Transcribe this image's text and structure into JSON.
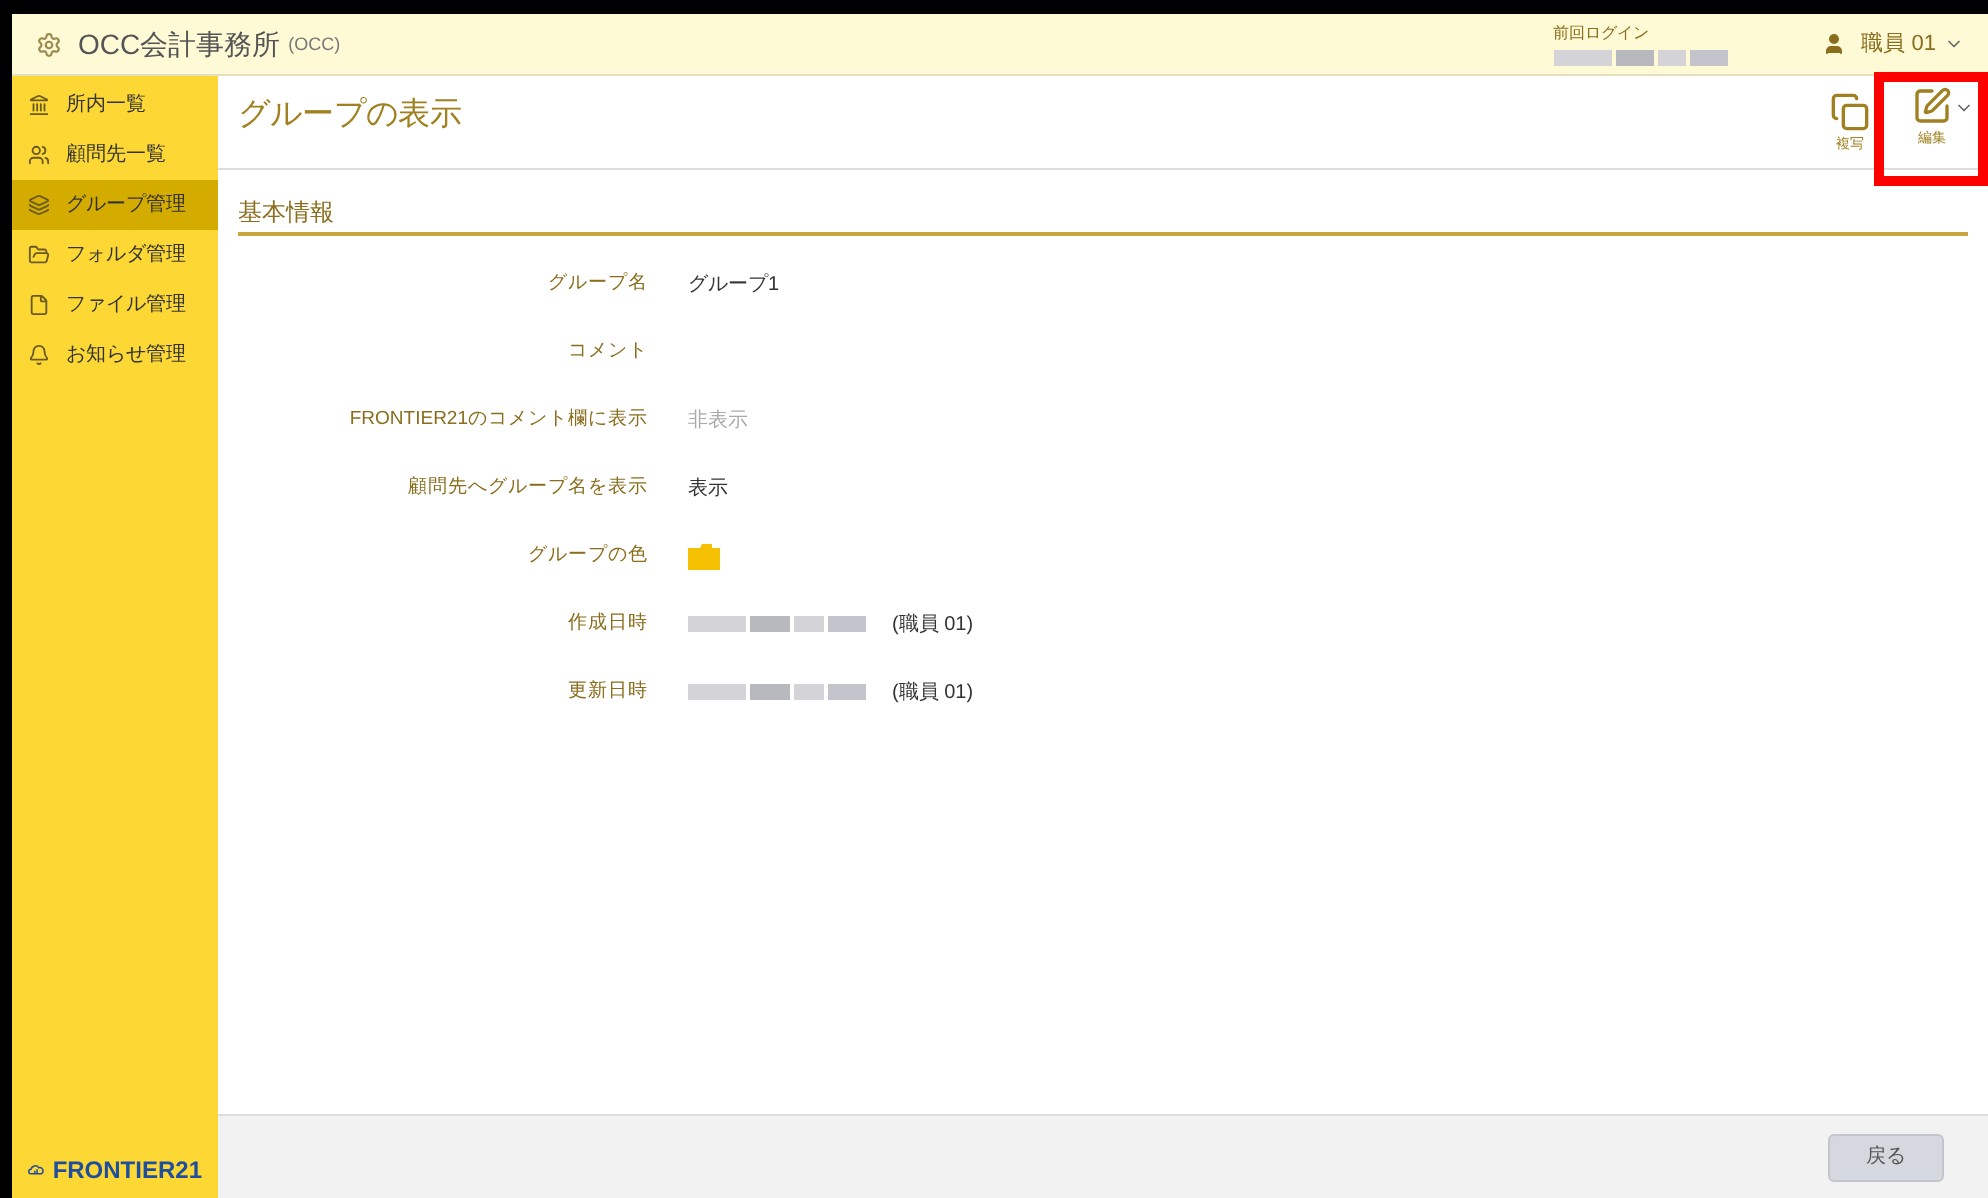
{
  "header": {
    "title": "OCC会計事務所",
    "subtitle": "(OCC)",
    "last_login_label": "前回ログイン",
    "user": "職員 01"
  },
  "sidebar": {
    "items": [
      {
        "label": "所内一覧",
        "selected": false
      },
      {
        "label": "顧問先一覧",
        "selected": false
      },
      {
        "label": "グループ管理",
        "selected": true
      },
      {
        "label": "フォルダ管理",
        "selected": false
      },
      {
        "label": "ファイル管理",
        "selected": false
      },
      {
        "label": "お知らせ管理",
        "selected": false
      }
    ],
    "logo": "FRONTIER21"
  },
  "page": {
    "title": "グループの表示",
    "toolbar": [
      {
        "label": "複写",
        "kind": "copy",
        "highlighted": false
      },
      {
        "label": "編集",
        "kind": "edit",
        "highlighted": true
      }
    ]
  },
  "section": {
    "title": "基本情報",
    "fields": [
      {
        "label": "グループ名",
        "kind": "text",
        "value": "グループ1"
      },
      {
        "label": "コメント",
        "kind": "text"
      },
      {
        "label": "FRONTIER21のコメント欄に表示",
        "kind": "text",
        "value": "非表示",
        "muted": true
      },
      {
        "label": "顧問先へグループ名を表示",
        "kind": "text",
        "value": "表示"
      },
      {
        "label": "グループの色",
        "kind": "color",
        "color": "#f5c000"
      },
      {
        "label": "作成日時",
        "kind": "stamp",
        "value": "(職員 01)"
      },
      {
        "label": "更新日時",
        "kind": "stamp",
        "value": "(職員 01)"
      }
    ]
  },
  "footer": {
    "back_button": "戻る"
  }
}
